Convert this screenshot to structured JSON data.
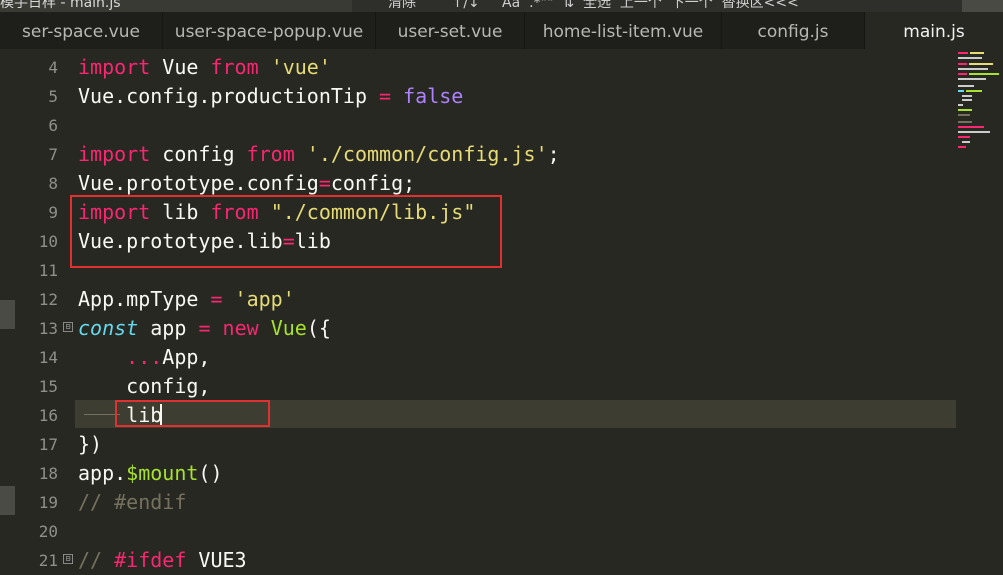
{
  "window": {
    "breadcrumb": "模手日样 - main.js",
    "find_bar_text": "清除        ↑/↓     Aa  .*\"\"  ⇅  全选  上一个  下一个  替换区<<<",
    "close_symbol": "×"
  },
  "tabs": [
    {
      "label": "ser-space.vue",
      "active": false
    },
    {
      "label": "user-space-popup.vue",
      "active": false
    },
    {
      "label": "user-set.vue",
      "active": false
    },
    {
      "label": "home-list-item.vue",
      "active": false
    },
    {
      "label": "config.js",
      "active": false
    },
    {
      "label": "main.js",
      "active": true
    }
  ],
  "editor": {
    "line_numbers": [
      "4",
      "5",
      "6",
      "7",
      "8",
      "9",
      "10",
      "11",
      "12",
      "13",
      "14",
      "15",
      "16",
      "17",
      "18",
      "19",
      "20",
      "21"
    ],
    "fold_marker": "⊟",
    "code": {
      "l4": {
        "a": "import",
        "b": " Vue ",
        "c": "from",
        "d": " ",
        "e": "'vue'"
      },
      "l5": {
        "a": "Vue.config.productionTip ",
        "b": "=",
        "c": " ",
        "d": "false"
      },
      "l7": {
        "a": "import",
        "b": " config ",
        "c": "from",
        "d": " ",
        "e": "'./common/config.js'",
        "f": ";"
      },
      "l8": {
        "a": "Vue.prototype.config",
        "b": "=",
        "c": "config;"
      },
      "l9": {
        "a": "import",
        "b": " lib ",
        "c": "from",
        "d": " ",
        "e": "\"./common/lib.js\""
      },
      "l10": {
        "a": "Vue.prototype.lib",
        "b": "=",
        "c": "lib"
      },
      "l12": {
        "a": "App.mpType ",
        "b": "=",
        "c": " ",
        "d": "'app'"
      },
      "l13": {
        "a": "const",
        "b": " app ",
        "c": "=",
        "d": " ",
        "e": "new",
        "f": " ",
        "g": "Vue",
        "h": "({"
      },
      "l14": {
        "a": "    ",
        "b": "...",
        "c": "App,"
      },
      "l15": {
        "a": "    config,"
      },
      "l16": {
        "a": "    lib"
      },
      "l17": {
        "a": "})"
      },
      "l18": {
        "a": "app.",
        "b": "$mount",
        "c": "()"
      },
      "l19": {
        "a": "// #endif"
      },
      "l21": {
        "a": "// ",
        "b": "#ifdef",
        "c": " ",
        "d": "VUE3"
      }
    }
  },
  "colors": {
    "keyword": "#f92672",
    "string": "#e6db74",
    "constant": "#ae81ff",
    "function": "#a6e22e",
    "storage": "#66d9ef",
    "comment": "#75715e",
    "highlight_box": "#e03030"
  }
}
